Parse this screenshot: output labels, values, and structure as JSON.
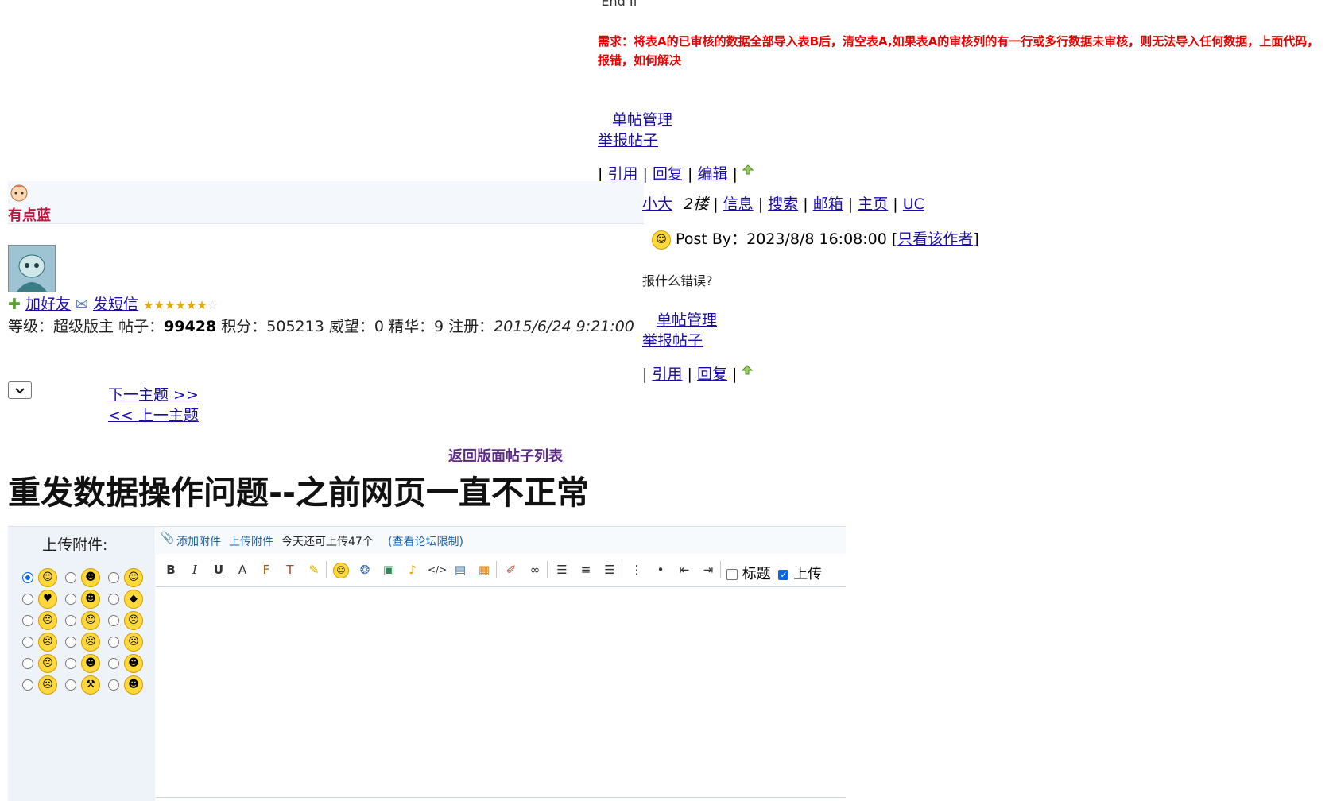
{
  "top_post": {
    "code_tail": "'End If",
    "requirement_text": "需求：将表A的已审核的数据全部导入表B后，清空表A,如果表A的审核列的有一行或多行数据未审核，则无法导入任何数据，上面代码，报错，如何解决",
    "manage_link": "单帖管理",
    "report_link": "举报帖子",
    "actions": [
      "引用",
      "回复",
      "编辑"
    ]
  },
  "reply_header": {
    "font_size_link": "小大",
    "floor": "2楼",
    "links": [
      "信息",
      "搜索",
      "邮箱",
      "主页",
      "UC"
    ],
    "post_by_prefix": "Post By：",
    "post_time": "2023/8/8 16:08:00",
    "only_author_link": "只看该作者"
  },
  "reply": {
    "content": "报什么错误?",
    "manage_link": "单帖管理",
    "report_link": "举报帖子",
    "actions": [
      "引用",
      "回复"
    ]
  },
  "user": {
    "name": "有点蓝",
    "add_friend": "加好友",
    "send_message": "发短信",
    "stats": {
      "level_label": "等级：",
      "level": "超级版主",
      "posts_label": "帖子：",
      "posts": "99428",
      "points_label": "积分：",
      "points": "505213",
      "prestige_label": "威望：",
      "prestige": "0",
      "essence_label": "精华：",
      "essence": "9",
      "register_label": "注册：",
      "register": "2015/6/24 9:21:00"
    }
  },
  "nav": {
    "next_topic": "下一主题 >>",
    "prev_topic": "<< 上一主题",
    "back_to_list": "返回版面帖子列表"
  },
  "topic_title": "重发数据操作问题--之前网页一直不正常",
  "editor": {
    "upload_label": "上传附件:",
    "add_attachment": "添加附件",
    "upload_attachment": "上传附件",
    "quota_text": "今天还可上传47个",
    "view_limits": "(查看论坛限制)",
    "toolbar_title_checkbox": "标题",
    "toolbar_upload_checkbox": "上传",
    "toolbar_buttons": [
      "bold",
      "italic",
      "underline",
      "font-size",
      "font-family",
      "text-color",
      "highlight",
      "emoticon",
      "flash",
      "image",
      "music",
      "code",
      "insert-image",
      "table",
      "clear-format",
      "link",
      "align-left",
      "align-center",
      "align-right",
      "ordered-list",
      "unordered-list",
      "outdent",
      "indent"
    ]
  },
  "colors": {
    "requirement_red": "#e60000",
    "username_red": "#c3153d",
    "link_blue": "#1a0dab",
    "back_list_purple": "#5b2a86"
  }
}
